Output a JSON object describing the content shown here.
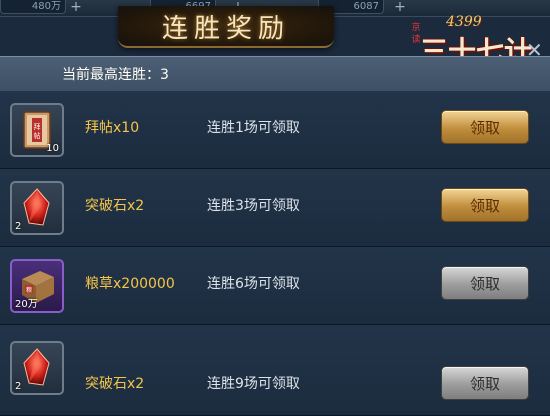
{
  "topbar": {
    "res1": "480万",
    "res2": "6697",
    "res3": "6087"
  },
  "title": "连胜奖励",
  "logo": {
    "brand": "4399",
    "seal": "京读",
    "name": "三十七计"
  },
  "stat": {
    "label": "当前最高连胜：",
    "value": "3"
  },
  "rewards": [
    {
      "name": "拜帖x10",
      "qty": "10",
      "condition": "连胜1场可领取",
      "button": "领取",
      "state": "active"
    },
    {
      "name": "突破石x2",
      "qty": "2",
      "condition": "连胜3场可领取",
      "button": "领取",
      "state": "active"
    },
    {
      "name": "粮草x200000",
      "qty": "20万",
      "condition": "连胜6场可领取",
      "button": "领取",
      "state": "disabled"
    },
    {
      "name": "突破石x2",
      "qty": "2",
      "condition": "连胜9场可领取",
      "button": "领取",
      "state": "disabled"
    }
  ],
  "colors": {
    "accent_gold": "#f5c54a",
    "button_gold": "#c18e3c",
    "button_grey": "#9c9c9c"
  }
}
